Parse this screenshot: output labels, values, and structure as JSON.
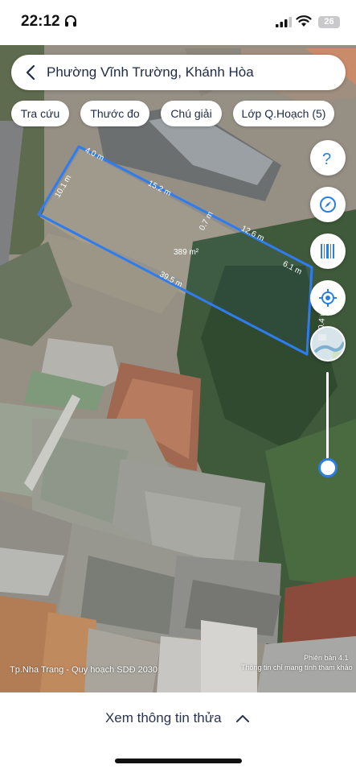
{
  "status_bar": {
    "time": "22:12",
    "battery": "26"
  },
  "search": {
    "title": "Phường Vĩnh Trường, Khánh Hòa"
  },
  "chips": [
    {
      "label": "Tra cứu"
    },
    {
      "label": "Thước đo"
    },
    {
      "label": "Chú giải"
    },
    {
      "label": "Lớp Q.Hoạch (5)"
    }
  ],
  "plot": {
    "area": "389 m²",
    "edges": [
      {
        "label": "4.0 m"
      },
      {
        "label": "15.2 m"
      },
      {
        "label": "0.7 m"
      },
      {
        "label": "12.6 m"
      },
      {
        "label": "6.1 m"
      },
      {
        "label": "10.4 m"
      },
      {
        "label": "39.5 m"
      },
      {
        "label": "10.1 m"
      }
    ],
    "outline_color": "#2f7cf0"
  },
  "map_controls": {
    "help": "help-icon",
    "compass": "compass-icon",
    "barcode": "barcode-icon",
    "locate": "locate-icon",
    "accent": "#2a7fe0"
  },
  "map_footer": {
    "caption": "Tp.Nha Trang - Quy hoạch SDĐ 2030",
    "version": "Phiên bản 4.1",
    "note": "Thông tin chỉ mang tính tham khảo"
  },
  "sheet": {
    "label": "Xem thông tin thửa"
  }
}
